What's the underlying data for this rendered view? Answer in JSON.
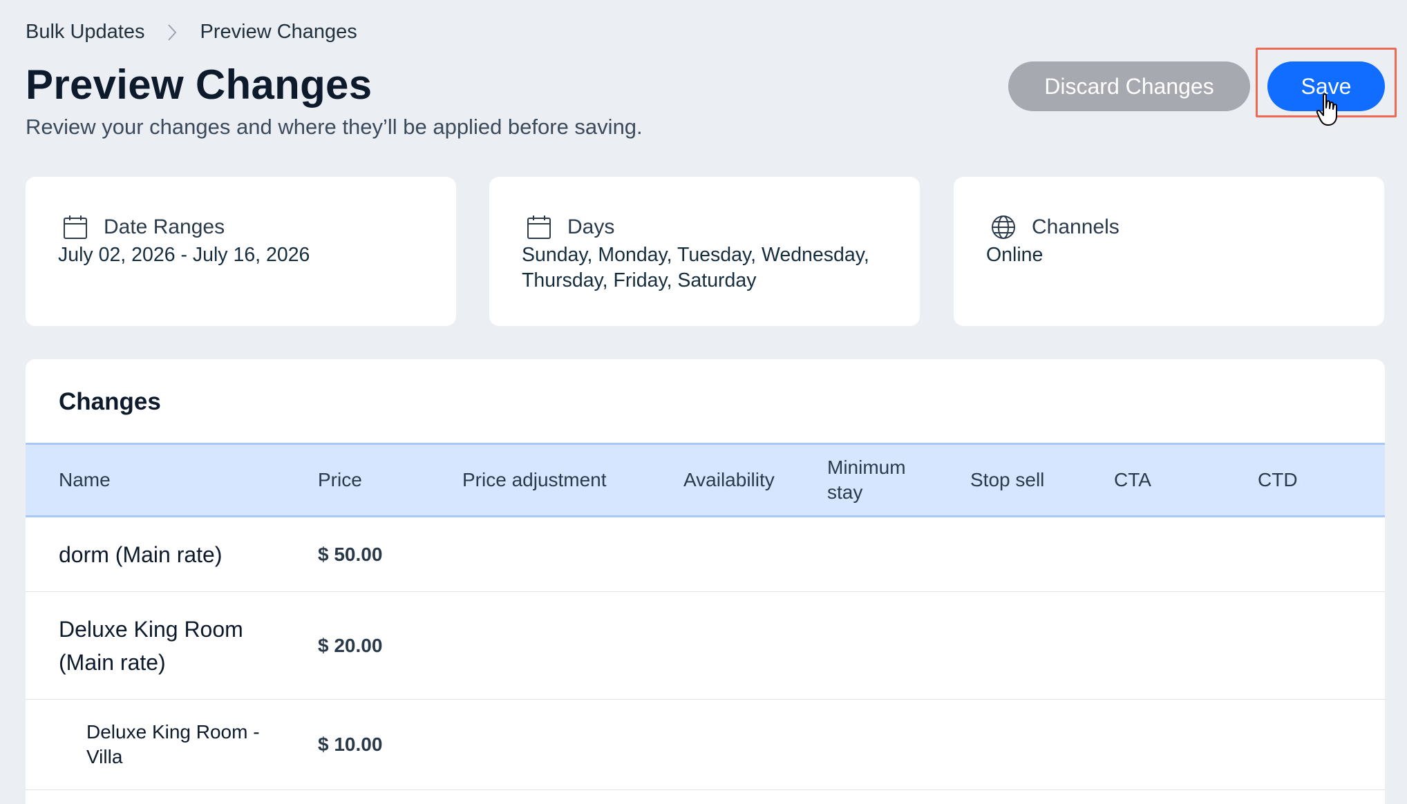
{
  "breadcrumb": {
    "parent": "Bulk Updates",
    "current": "Preview Changes"
  },
  "header": {
    "title": "Preview Changes",
    "subtitle": "Review your changes and where they’ll be applied before saving.",
    "discard_label": "Discard Changes",
    "save_label": "Save"
  },
  "summary": {
    "date_ranges": {
      "label": "Date Ranges",
      "icon": "calendar-icon",
      "value": "July 02, 2026 - July 16, 2026"
    },
    "days": {
      "label": "Days",
      "icon": "calendar-icon",
      "line1": "Sunday, Monday, Tuesday, Wednesday,",
      "line2": "Thursday, Friday, Saturday"
    },
    "channels": {
      "label": "Channels",
      "icon": "globe-icon",
      "value": "Online"
    }
  },
  "changes": {
    "title": "Changes",
    "columns": {
      "name": "Name",
      "price": "Price",
      "price_adjustment": "Price adjustment",
      "availability": "Availability",
      "minimum_stay_1": "Minimum",
      "minimum_stay_2": "stay",
      "stop_sell": "Stop sell",
      "cta": "CTA",
      "ctd": "CTD"
    },
    "rows": [
      {
        "name_1": "dorm (Main rate)",
        "name_2": "",
        "price": "$ 50.00"
      },
      {
        "name_1": "Deluxe King Room",
        "name_2": "(Main rate)",
        "price": "$ 20.00"
      },
      {
        "name_1": "Deluxe King Room -",
        "name_2": "Villa",
        "price": "$ 10.00"
      }
    ]
  },
  "colors": {
    "background": "#ebeef3",
    "primary": "#116dff",
    "discard": "#a6a9b0",
    "table_header": "#d6e6fe",
    "highlight": "#ef6a55"
  }
}
